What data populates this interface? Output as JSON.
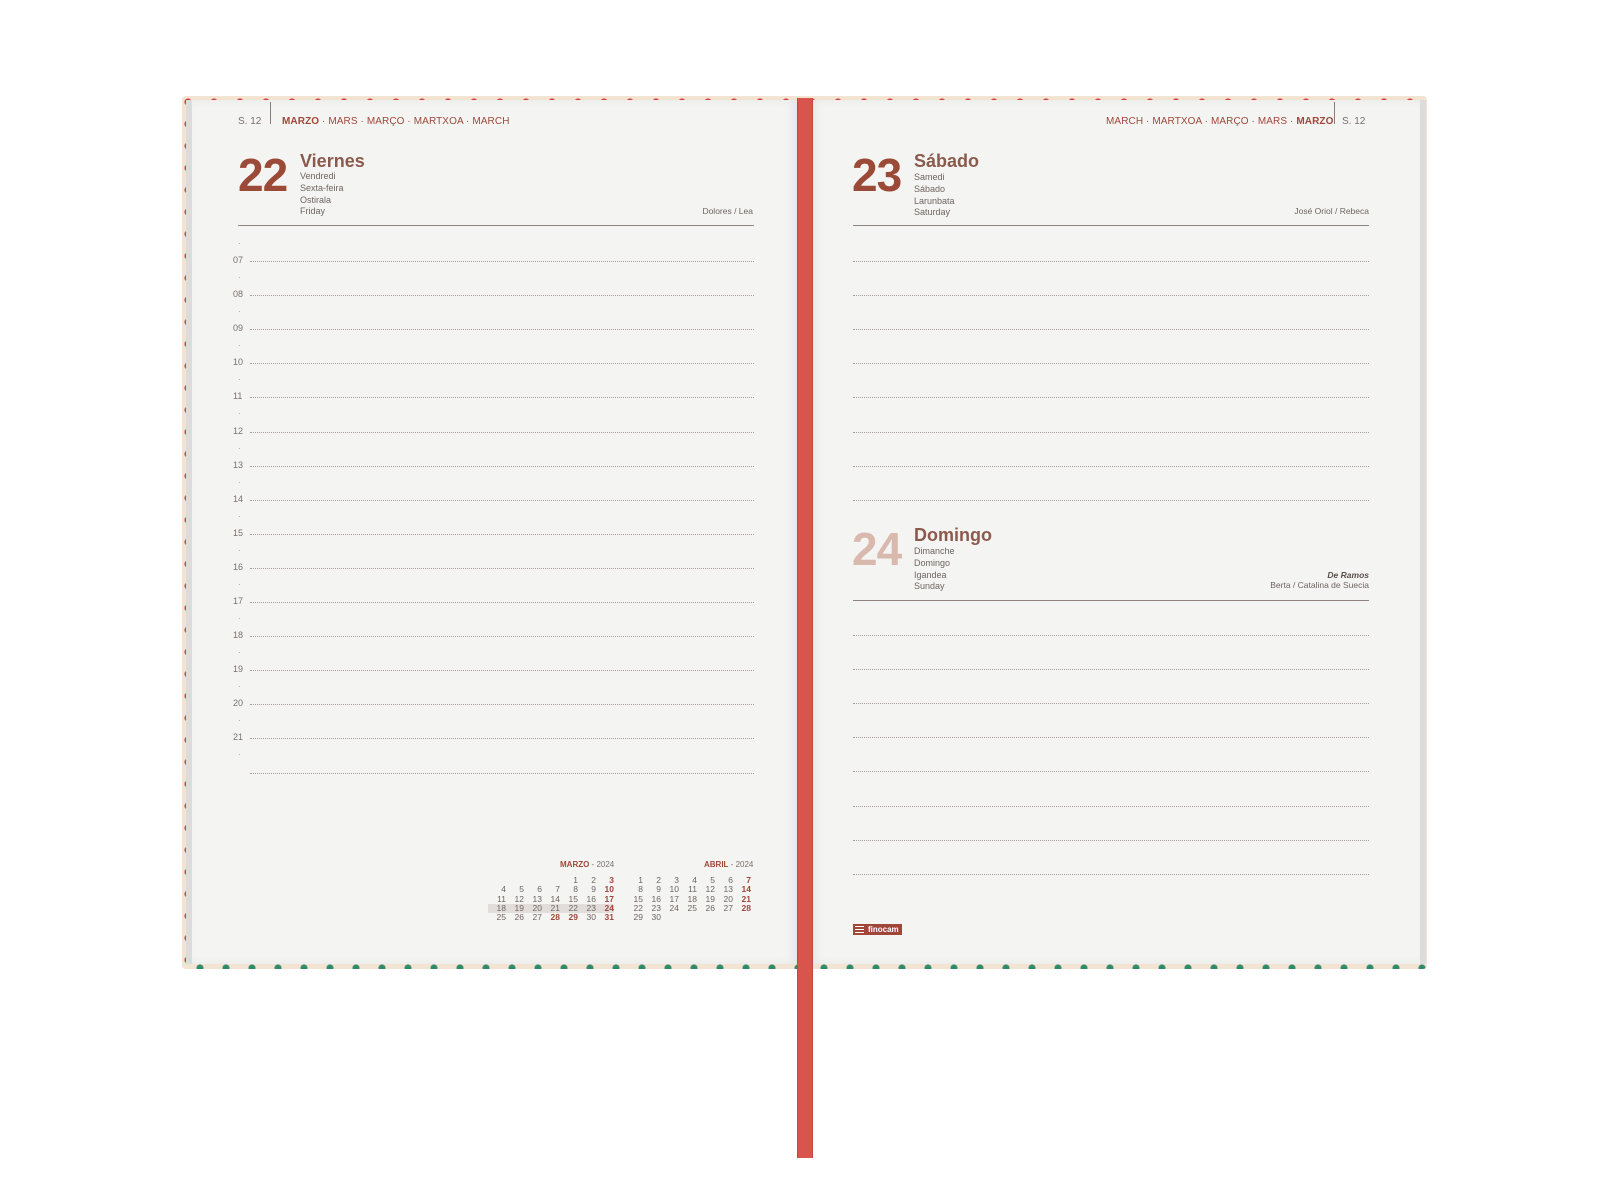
{
  "left": {
    "week": "S. 12",
    "months_bold": "MARZO",
    "months_rest": " · MARS · MARÇO · MARTXOA · MARCH",
    "day": {
      "number": "22",
      "name": "Viernes",
      "langs": [
        "Vendredi",
        "Sexta-feira",
        "Ostirala",
        "Friday"
      ],
      "saint": "Dolores / Lea"
    },
    "hours": [
      "07",
      "08",
      "09",
      "10",
      "11",
      "12",
      "13",
      "14",
      "15",
      "16",
      "17",
      "18",
      "19",
      "20",
      "21"
    ]
  },
  "right": {
    "week": "S. 12",
    "months_rest": "MARCH · MARTXOA · MARÇO · MARS · ",
    "months_bold": "MARZO",
    "day1": {
      "number": "23",
      "name": "Sábado",
      "langs": [
        "Samedi",
        "Sábado",
        "Larunbata",
        "Saturday"
      ],
      "saint": "José Oriol / Rebeca"
    },
    "day2": {
      "number": "24",
      "name": "Domingo",
      "langs": [
        "Dimanche",
        "Domingo",
        "Igandea",
        "Sunday"
      ],
      "feast": "De Ramos",
      "saint": "Berta / Catalina de Suecia"
    },
    "brand": "finocam"
  },
  "calendars": {
    "march": {
      "title_month": "MARZO",
      "title_year": " - 2024",
      "rows": [
        [
          "",
          "",
          "",
          "",
          "1",
          "2",
          "3"
        ],
        [
          "4",
          "5",
          "6",
          "7",
          "8",
          "9",
          "10"
        ],
        [
          "11",
          "12",
          "13",
          "14",
          "15",
          "16",
          "17"
        ],
        [
          "18",
          "19",
          "20",
          "21",
          "22",
          "23",
          "24"
        ],
        [
          "25",
          "26",
          "27",
          "28",
          "29",
          "30",
          "31"
        ]
      ]
    },
    "april": {
      "title_month": "ABRIL",
      "title_year": " - 2024",
      "rows": [
        [
          "1",
          "2",
          "3",
          "4",
          "5",
          "6",
          "7"
        ],
        [
          "8",
          "9",
          "10",
          "11",
          "12",
          "13",
          "14"
        ],
        [
          "15",
          "16",
          "17",
          "18",
          "19",
          "20",
          "21"
        ],
        [
          "22",
          "23",
          "24",
          "25",
          "26",
          "27",
          "28"
        ],
        [
          "29",
          "30",
          "",
          "",
          "",
          "",
          ""
        ]
      ]
    }
  },
  "colors": {
    "accent": "#a0473a",
    "ribbon": "#d9544c",
    "page": "#f4f4f3"
  }
}
